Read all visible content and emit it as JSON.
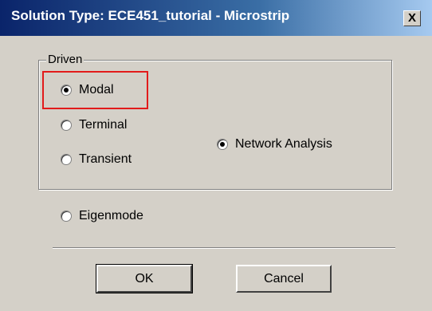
{
  "window": {
    "title": "Solution Type: ECE451_tutorial - Microstrip",
    "close_label": "X"
  },
  "driven_group": {
    "label": "Driven",
    "options": [
      {
        "label": "Modal",
        "checked": true
      },
      {
        "label": "Terminal",
        "checked": false
      },
      {
        "label": "Transient",
        "checked": false
      }
    ],
    "network_analysis": {
      "label": "Network Analysis",
      "checked": true
    }
  },
  "eigenmode": {
    "label": "Eigenmode",
    "checked": false
  },
  "buttons": {
    "ok_label": "OK",
    "cancel_label": "Cancel"
  },
  "colors": {
    "dialog_bg": "#d4d0c8",
    "titlebar_start": "#0a246a",
    "titlebar_end": "#a6caf0",
    "highlight": "#e21b1b"
  }
}
